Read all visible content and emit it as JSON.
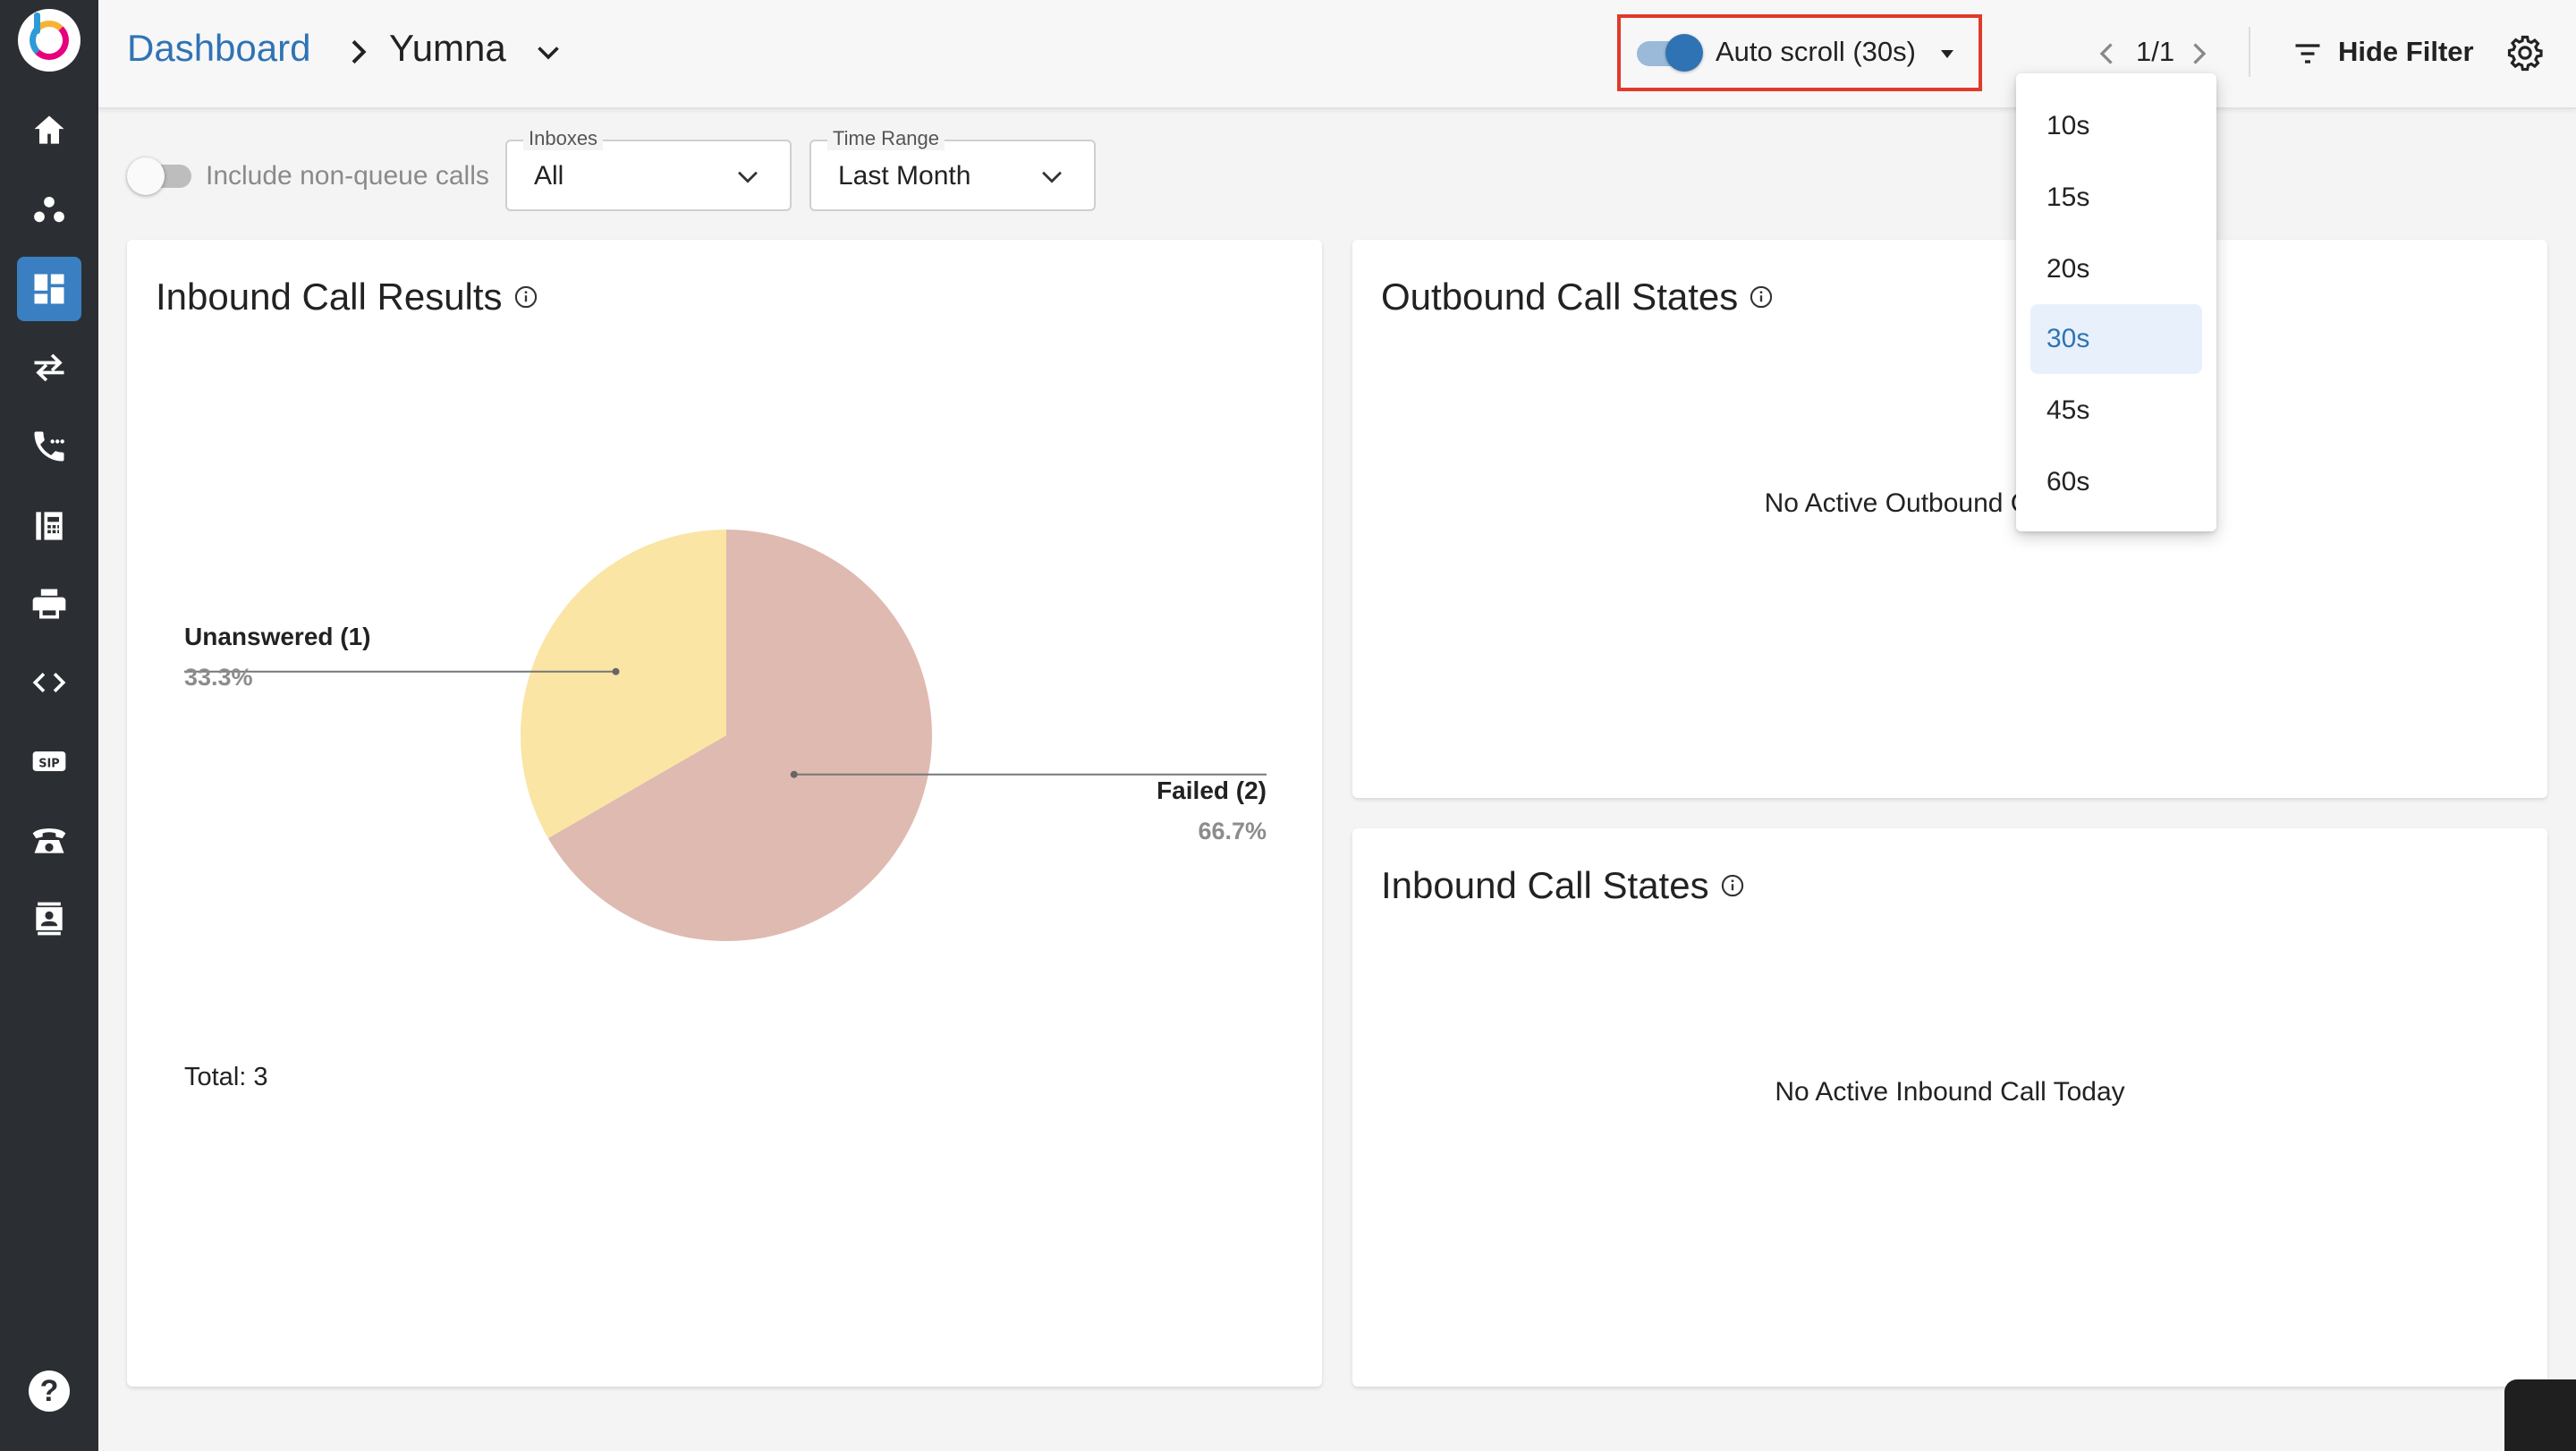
{
  "header": {
    "breadcrumb_root": "Dashboard",
    "breadcrumb_current": "Yumna",
    "auto_scroll_label": "Auto scroll (30s)",
    "auto_scroll_enabled": true,
    "pager": "1/1",
    "hide_filter_label": "Hide Filter"
  },
  "sidebar": {
    "items": [
      {
        "icon": "home-icon"
      },
      {
        "icon": "agents-icon"
      },
      {
        "icon": "dashboard-icon",
        "active": true
      },
      {
        "icon": "transfer-icon"
      },
      {
        "icon": "call-icon"
      },
      {
        "icon": "fax-icon"
      },
      {
        "icon": "printer-icon"
      },
      {
        "icon": "code-icon"
      },
      {
        "icon": "sip-icon"
      },
      {
        "icon": "telephone-icon"
      },
      {
        "icon": "contacts-icon"
      }
    ],
    "help_label": "?"
  },
  "filters": {
    "include_non_queue_label": "Include non-queue calls",
    "include_non_queue_enabled": false,
    "inboxes_legend": "Inboxes",
    "inboxes_value": "All",
    "time_range_legend": "Time Range",
    "time_range_value": "Last Month"
  },
  "cards": {
    "inbound_results_title": "Inbound Call Results",
    "outbound_states_title": "Outbound Call States",
    "outbound_empty": "No Active Outbound Call Today",
    "inbound_states_title": "Inbound Call States",
    "inbound_empty": "No Active Inbound Call Today"
  },
  "chart_data": {
    "type": "pie",
    "title": "Inbound Call Results",
    "slices": [
      {
        "label": "Failed (2)",
        "value": 2,
        "percent": "66.7%",
        "color": "#dfbab1"
      },
      {
        "label": "Unanswered (1)",
        "value": 1,
        "percent": "33.3%",
        "color": "#fae5a5"
      }
    ],
    "total_label": "Total: 3"
  },
  "dropdown": {
    "options": [
      "10s",
      "15s",
      "20s",
      "30s",
      "45s",
      "60s"
    ],
    "selected": "30s"
  },
  "colors": {
    "accent": "#2f73b5",
    "highlight_border": "#e03a2a",
    "sidebar_bg": "#2b2f33"
  }
}
